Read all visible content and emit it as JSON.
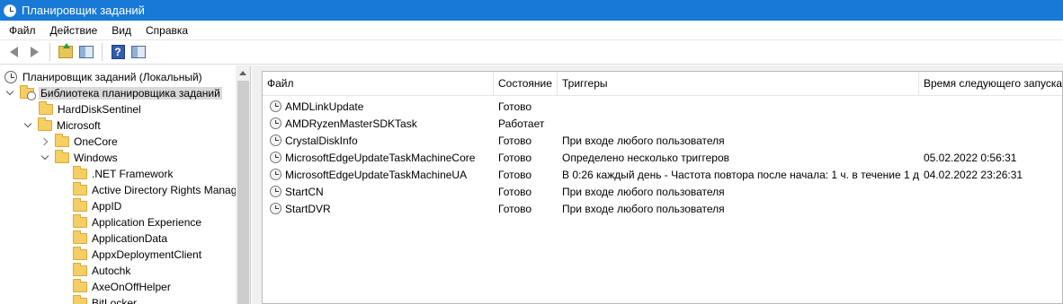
{
  "window": {
    "title": "Планировщик заданий"
  },
  "menu": [
    "Файл",
    "Действие",
    "Вид",
    "Справка"
  ],
  "toolbar": {
    "icons": [
      "back-arrow-icon",
      "forward-arrow-icon",
      "up-folder-icon",
      "show-hide-console-tree-icon",
      "help-icon",
      "show-hide-action-pane-icon"
    ],
    "help_label": "?"
  },
  "tree": {
    "root": "Планировщик заданий (Локальный)",
    "library": "Библиотека планировщика заданий",
    "hard_disk": "HardDiskSentinel",
    "microsoft": "Microsoft",
    "onecore": "OneCore",
    "windows": "Windows",
    "windows_children": [
      ".NET Framework",
      "Active Directory Rights Manag",
      "AppID",
      "Application Experience",
      "ApplicationData",
      "AppxDeploymentClient",
      "Autochk",
      "AxeOnOffHelper",
      "BitLocker"
    ]
  },
  "list": {
    "columns": [
      "Файл",
      "Состояние",
      "Триггеры",
      "Время следующего запуска"
    ],
    "rows": [
      {
        "name": "AMDLinkUpdate",
        "status": "Готово",
        "trigger": "",
        "next_run": ""
      },
      {
        "name": "AMDRyzenMasterSDKTask",
        "status": "Работает",
        "trigger": "",
        "next_run": ""
      },
      {
        "name": "CrystalDiskInfo",
        "status": "Готово",
        "trigger": "При входе любого пользователя",
        "next_run": ""
      },
      {
        "name": "MicrosoftEdgeUpdateTaskMachineCore",
        "status": "Готово",
        "trigger": "Определено несколько триггеров",
        "next_run": "05.02.2022 0:56:31"
      },
      {
        "name": "MicrosoftEdgeUpdateTaskMachineUA",
        "status": "Готово",
        "trigger": "В 0:26 каждый день - Частота повтора после начала: 1 ч. в течение 1 д..",
        "next_run": "04.02.2022 23:26:31"
      },
      {
        "name": "StartCN",
        "status": "Готово",
        "trigger": "При входе любого пользователя",
        "next_run": ""
      },
      {
        "name": "StartDVR",
        "status": "Готово",
        "trigger": "При входе любого пользователя",
        "next_run": ""
      }
    ]
  },
  "colors": {
    "titlebar": "#1879d6",
    "selection": "#d9d9d9",
    "folder": "#f5cf63"
  }
}
